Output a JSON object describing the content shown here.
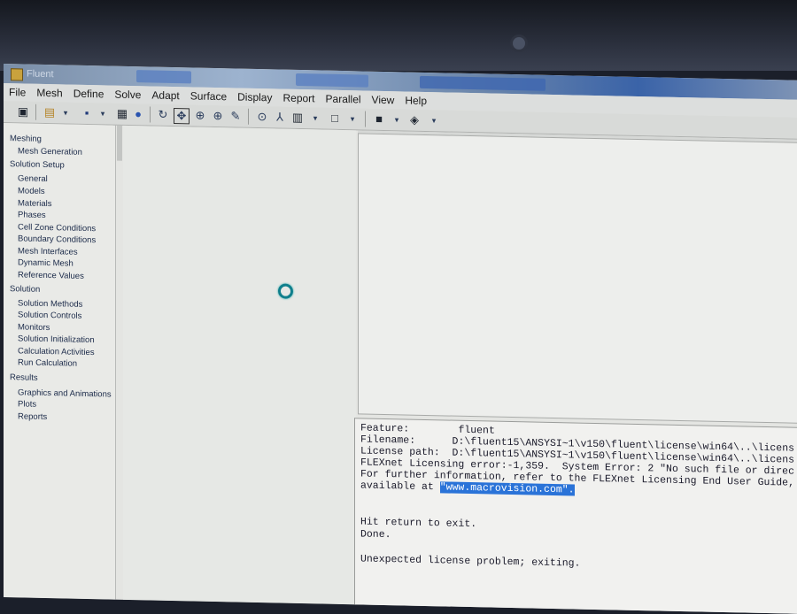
{
  "window": {
    "title": "Fluent",
    "taskbar_tabs": [
      "",
      "",
      ""
    ]
  },
  "menu": [
    "File",
    "Mesh",
    "Define",
    "Solve",
    "Adapt",
    "Surface",
    "Display",
    "Report",
    "Parallel",
    "View",
    "Help"
  ],
  "toolbar_icons": [
    "open-icon",
    "read-icon",
    "save-icon",
    "print-icon",
    "help-icon",
    "rotate-icon",
    "translate-icon",
    "zoom-icon",
    "zoom-in-icon",
    "probe-icon",
    "zoom-to-fit-icon",
    "axes-icon",
    "views-icon",
    "layout-icon",
    "colormap-icon",
    "render-icon"
  ],
  "tree": {
    "groups": [
      {
        "label": "Meshing",
        "items": [
          "Mesh Generation"
        ]
      },
      {
        "label": "Solution Setup",
        "items": [
          "General",
          "Models",
          "Materials",
          "Phases",
          "Cell Zone Conditions",
          "Boundary Conditions",
          "Mesh Interfaces",
          "Dynamic Mesh",
          "Reference Values"
        ]
      },
      {
        "label": "Solution",
        "items": [
          "Solution Methods",
          "Solution Controls",
          "Monitors",
          "Solution Initialization",
          "Calculation Activities",
          "Run Calculation"
        ]
      },
      {
        "label": "Results",
        "items": [
          "Graphics and Animations",
          "Plots",
          "Reports"
        ]
      }
    ]
  },
  "console": {
    "feature_label": "Feature:",
    "feature_value": "fluent",
    "filename_label": "Filename:",
    "filename_value": "D:\\fluent15\\ANSYSI~1\\v150\\fluent\\license\\win64\\..\\licens",
    "license_label": "License path:",
    "license_value": "D:\\fluent15\\ANSYSI~1\\v150\\fluent\\license\\win64\\..\\licens",
    "error_line": "FLEXnet Licensing error:-1,359.  System Error: 2 \"No such file or direc",
    "info_line": "For further information, refer to the FLEXnet Licensing End User Guide,",
    "available_prefix": "available at ",
    "available_link": "\"www.macrovision.com\".",
    "hit_return": "Hit return to exit.",
    "done": "Done.",
    "unexpected": "Unexpected license problem; exiting."
  }
}
